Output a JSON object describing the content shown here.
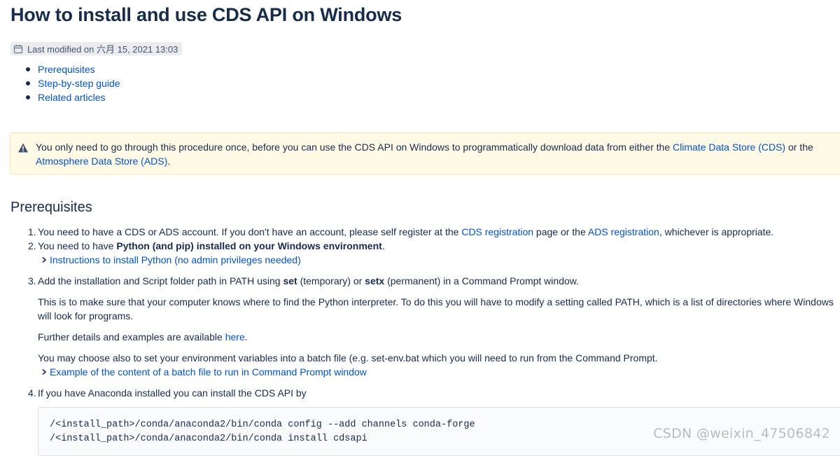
{
  "page": {
    "title": "How to install and use CDS API on Windows",
    "last_modified": "Last modified on 六月 15, 2021 13:03"
  },
  "toc": [
    {
      "label": "Prerequisites"
    },
    {
      "label": "Step-by-step guide"
    },
    {
      "label": "Related articles"
    }
  ],
  "warning": {
    "text_before": "You only need to go through this procedure once, before you can use the CDS API on Windows to programmatically download data from either the ",
    "link1": "Climate Data Store (CDS)",
    "text_middle": " or the ",
    "link2": "Atmosphere Data Store (ADS)",
    "text_after": "."
  },
  "prerequisites": {
    "heading": "Prerequisites",
    "step1": {
      "num": "1.",
      "text_before": "You need to have a CDS or ADS account. If you don't have an account, please self register at the ",
      "link1": "CDS registration",
      "text_middle": " page or the ",
      "link2": "ADS registration",
      "text_after": ", whichever is appropriate."
    },
    "step2": {
      "num": "2.",
      "text_before": "You need to have ",
      "bold": "Python (and pip) installed on your Windows environment",
      "text_after": ".",
      "expand": "Instructions to install Python (no admin privileges needed)"
    },
    "step3": {
      "num": "3.",
      "text_before": "Add the installation and Script folder path in PATH using ",
      "bold1": "set",
      "text_middle": " (temporary) or ",
      "bold2": "setx",
      "text_after": " (permanent) in a Command Prompt window.",
      "para1": "This is to make sure that your computer knows where to find the Python interpreter. To do this you will have to modify a setting called PATH, which is a list of directories where Windows will look for programs.",
      "para2_before": "Further details and examples are available ",
      "para2_link": "here",
      "para2_after": ".",
      "para3": "You may choose also to set your environment variables into a batch file (e.g. set-env.bat which you will need to run from the Command Prompt.",
      "expand": "Example of the content of a batch file to run in Command Prompt window"
    },
    "step4": {
      "num": "4.",
      "text": "If you have Anaconda installed you can install the CDS API by",
      "code": [
        "/<install_path>/conda/anaconda2/bin/conda config --add channels conda-forge",
        "/<install_path>/conda/anaconda2/bin/conda install cdsapi"
      ]
    }
  },
  "watermark": "CSDN @weixin_47506842",
  "colors": {
    "link": "#0052cc",
    "text": "#172b4d",
    "warning_bg": "#fffae6",
    "meta_bg": "#ebecf0"
  },
  "icons": {
    "meta": "calendar-icon",
    "warning": "warning-triangle-icon",
    "expand": "chevron-right-icon"
  }
}
